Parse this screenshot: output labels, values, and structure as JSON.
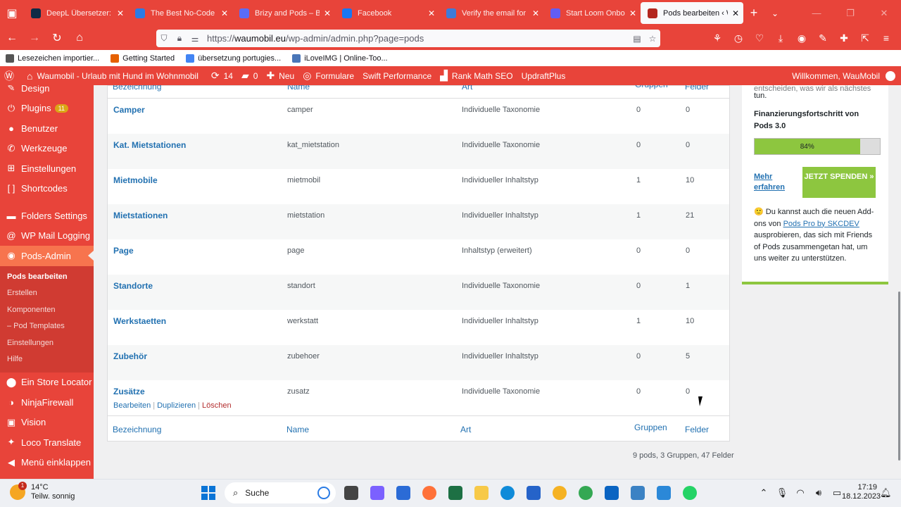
{
  "browser": {
    "tabs": [
      {
        "label": "DeepL Übersetzer: De",
        "icon": "deepl-icon",
        "color": "#0f2b46",
        "active": false
      },
      {
        "label": "The Best No-Code W",
        "icon": "globe-icon",
        "color": "#2a7be4",
        "active": false
      },
      {
        "label": "Brizy and Pods – Brizy",
        "icon": "brizy-icon",
        "color": "#5b6cf7",
        "active": false
      },
      {
        "label": "Facebook",
        "icon": "facebook-icon",
        "color": "#1877f2",
        "active": false
      },
      {
        "label": "Verify the email for yo",
        "icon": "asterisk-icon",
        "color": "#3d7bd9",
        "active": false
      },
      {
        "label": "Start Loom Onboardin",
        "icon": "loom-icon",
        "color": "#625df5",
        "active": false
      },
      {
        "label": "Pods bearbeiten ‹ Wau",
        "icon": "pods-icon",
        "color": "#b3261e",
        "active": true
      }
    ],
    "url_prefix": "https://",
    "url_host": "waumobil.eu",
    "url_path": "/wp-admin/admin.php?page=pods",
    "bookmarks": [
      {
        "label": "Lesezeichen importier...",
        "color": "#555"
      },
      {
        "label": "Getting Started",
        "color": "#e66000"
      },
      {
        "label": "übersetzung portugies...",
        "color": "#4285f4"
      },
      {
        "label": "iLoveIMG | Online-Too...",
        "color": "#4a76b8"
      }
    ]
  },
  "adminbar": {
    "site": "Waumobil - Urlaub mit Hund im Wohnmobil",
    "updates": "14",
    "comments": "0",
    "new": "Neu",
    "forms": "Formulare",
    "swift": "Swift Performance",
    "rankmath": "Rank Math SEO",
    "updraft": "UpdraftPlus",
    "welcome": "Willkommen, WauMobil"
  },
  "sidebar": {
    "items_top": [
      {
        "label": "Design",
        "icon": "brush-icon"
      },
      {
        "label": "Plugins",
        "icon": "plug-icon",
        "badge": "11"
      },
      {
        "label": "Benutzer",
        "icon": "user-icon"
      },
      {
        "label": "Werkzeuge",
        "icon": "wrench-icon"
      },
      {
        "label": "Einstellungen",
        "icon": "settings-icon"
      },
      {
        "label": "Shortcodes",
        "icon": "brackets-icon"
      }
    ],
    "items_mid": [
      {
        "label": "Folders Settings",
        "icon": "folder-icon"
      },
      {
        "label": "WP Mail Logging",
        "icon": "at-icon"
      },
      {
        "label": "Pods-Admin",
        "icon": "pods-icon",
        "current": true
      }
    ],
    "submenu": [
      "Pods bearbeiten",
      "Erstellen",
      "Komponenten",
      "– Pod Templates",
      "Einstellungen",
      "Hilfe"
    ],
    "items_bottom": [
      {
        "label": "Ein Store Locator",
        "icon": "pin-icon"
      },
      {
        "label": "NinjaFirewall",
        "icon": "ninja-icon"
      },
      {
        "label": "Vision",
        "icon": "vision-icon"
      },
      {
        "label": "Loco Translate",
        "icon": "translate-icon"
      },
      {
        "label": "Menü einklappen",
        "icon": "collapse-icon"
      }
    ]
  },
  "table": {
    "headers": {
      "name": "Bezeichnung",
      "slug": "Name",
      "type": "Art",
      "groups": "Gruppen",
      "fields": "Felder"
    },
    "rows": [
      {
        "label": "Camper",
        "slug": "camper",
        "type": "Individuelle Taxonomie",
        "groups": "0",
        "fields": "0"
      },
      {
        "label": "Kat. Mietstationen",
        "slug": "kat_mietstation",
        "type": "Individuelle Taxonomie",
        "groups": "0",
        "fields": "0"
      },
      {
        "label": "Mietmobile",
        "slug": "mietmobil",
        "type": "Individueller Inhaltstyp",
        "groups": "1",
        "fields": "10"
      },
      {
        "label": "Mietstationen",
        "slug": "mietstation",
        "type": "Individueller Inhaltstyp",
        "groups": "1",
        "fields": "21"
      },
      {
        "label": "Page",
        "slug": "page",
        "type": "Inhaltstyp (erweitert)",
        "groups": "0",
        "fields": "0"
      },
      {
        "label": "Standorte",
        "slug": "standort",
        "type": "Individuelle Taxonomie",
        "groups": "0",
        "fields": "1"
      },
      {
        "label": "Werkstaetten",
        "slug": "werkstatt",
        "type": "Individueller Inhaltstyp",
        "groups": "1",
        "fields": "10"
      },
      {
        "label": "Zubehör",
        "slug": "zubehoer",
        "type": "Individueller Inhaltstyp",
        "groups": "0",
        "fields": "5"
      },
      {
        "label": "Zusätze",
        "slug": "zusatz",
        "type": "Individuelle Taxonomie",
        "groups": "0",
        "fields": "0"
      }
    ],
    "row_actions": {
      "edit": "Bearbeiten",
      "duplicate": "Duplizieren",
      "delete": "Löschen"
    },
    "summary": "9 pods, 3 Gruppen, 47 Felder"
  },
  "widget": {
    "cut_text": "entscheiden, was wir als nächstes",
    "top_text": "tun.",
    "progress_label": "Finanzierungsfortschritt von Pods 3.0",
    "progress_value": 84,
    "progress_text": "84%",
    "more": "Mehr erfahren",
    "donate": "JETZT SPENDEN »",
    "text_before": "Du kannst auch die neuen Add-ons von ",
    "link": "Pods Pro by SKCDEV",
    "text_after": " ausprobieren, das sich mit Friends of Pods zusammengetan hat, um uns weiter zu unterstützen."
  },
  "taskbar": {
    "temp": "14°C",
    "weather": "Teilw. sonnig",
    "weather_badge": "1",
    "search": "Suche",
    "time": "17:19",
    "date": "18.12.2023",
    "apps": [
      {
        "name": "files-icon",
        "color": "#444"
      },
      {
        "name": "chat-icon",
        "color": "#7b61ff"
      },
      {
        "name": "vscode-icon",
        "color": "#2b6bd6"
      },
      {
        "name": "firefox-icon",
        "color": "#ff7139"
      },
      {
        "name": "excel-icon",
        "color": "#1d7044"
      },
      {
        "name": "explorer-icon",
        "color": "#f7c948"
      },
      {
        "name": "edge-icon",
        "color": "#0f8bd9"
      },
      {
        "name": "store-icon",
        "color": "#2563c9"
      },
      {
        "name": "photos-icon",
        "color": "#f5b223"
      },
      {
        "name": "chrome-icon",
        "color": "#34a853"
      },
      {
        "name": "outlook-icon",
        "color": "#0a64c2"
      },
      {
        "name": "notepad-icon",
        "color": "#3b82c4"
      },
      {
        "name": "snipping-icon",
        "color": "#2b88d8"
      },
      {
        "name": "whatsapp-icon",
        "color": "#25d366"
      }
    ]
  }
}
